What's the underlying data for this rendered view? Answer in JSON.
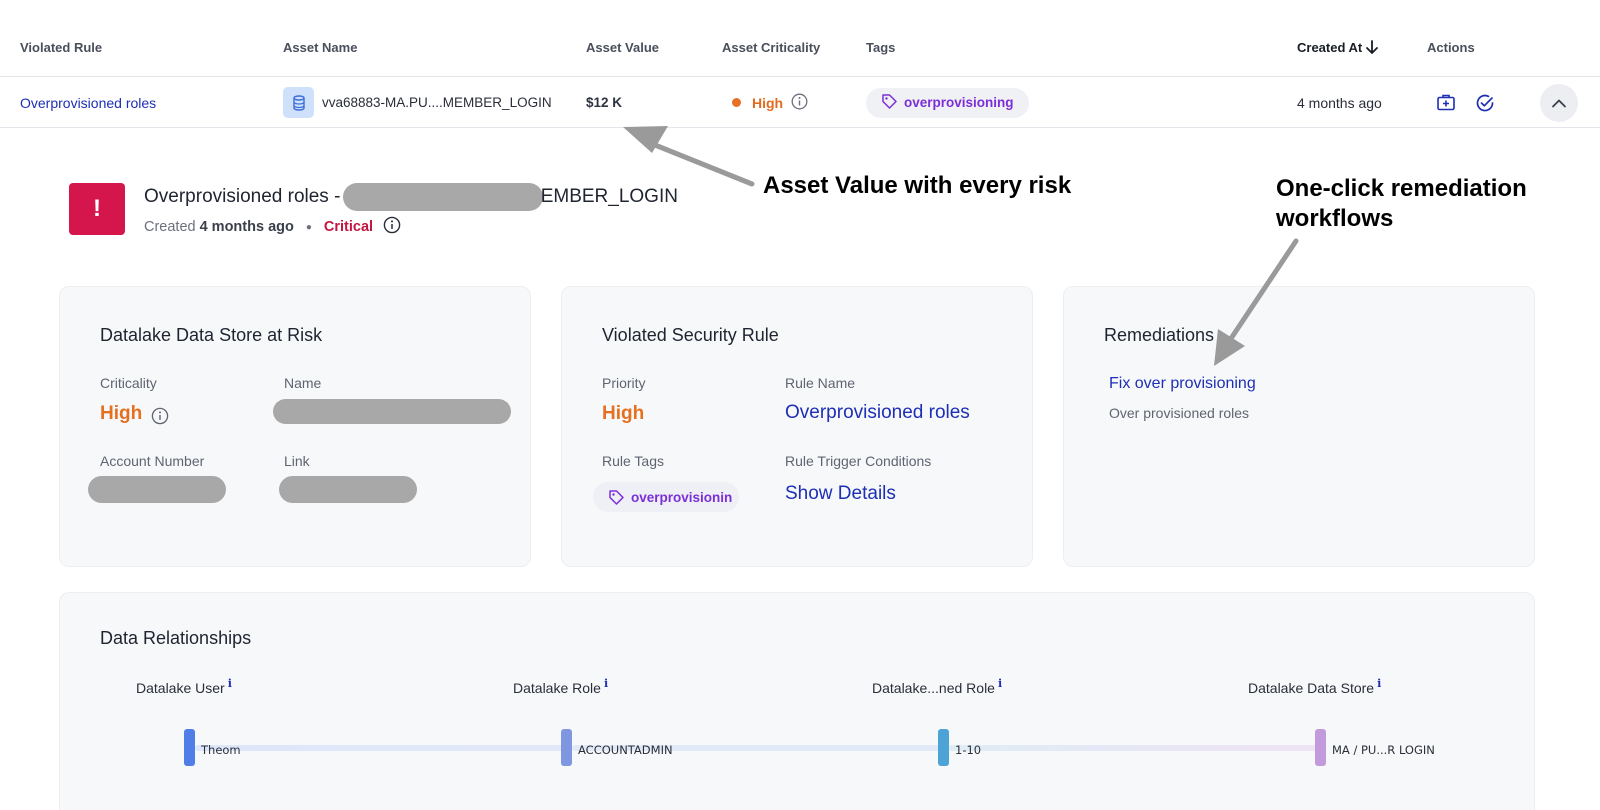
{
  "table": {
    "headers": {
      "violated_rule": "Violated Rule",
      "asset_name": "Asset Name",
      "asset_value": "Asset Value",
      "asset_criticality": "Asset Criticality",
      "tags": "Tags",
      "created_at": "Created At",
      "actions": "Actions"
    },
    "row": {
      "violated_rule": "Overprovisioned roles",
      "asset_name": "vva68883-MA.PU....MEMBER_LOGIN",
      "asset_value": "$12 K",
      "criticality": "High",
      "tag": "overprovisioning",
      "created_at": "4 months ago"
    }
  },
  "detail": {
    "title_prefix": "Overprovisioned roles - ",
    "title_suffix": "EMBER_LOGIN",
    "created_label": "Created",
    "created_value": "4 months ago",
    "severity": "Critical",
    "alert_glyph": "!"
  },
  "annotations": {
    "asset_value": "Asset Value with every risk",
    "remediation_line1": "One-click remediation",
    "remediation_line2": "workflows"
  },
  "card_datastore": {
    "title": "Datalake Data Store at Risk",
    "criticality_label": "Criticality",
    "criticality_value": "High",
    "name_label": "Name",
    "account_label": "Account Number",
    "link_label": "Link"
  },
  "card_rule": {
    "title": "Violated Security Rule",
    "priority_label": "Priority",
    "priority_value": "High",
    "rule_name_label": "Rule Name",
    "rule_name_value": "Overprovisioned roles",
    "rule_tags_label": "Rule Tags",
    "rule_tag_value": "overprovisionin",
    "trigger_label": "Rule Trigger Conditions",
    "trigger_value": "Show Details"
  },
  "card_remediations": {
    "title": "Remediations",
    "link": "Fix over provisioning",
    "desc": "Over provisioned roles"
  },
  "relationships": {
    "title": "Data Relationships",
    "info_glyph": "i",
    "columns": [
      {
        "header": "Datalake User",
        "node": "Theom",
        "color": "#4f7fe6"
      },
      {
        "header": "Datalake Role",
        "node": "ACCOUNTADMIN",
        "color": "#7e97e0"
      },
      {
        "header": "Datalake...ned Role",
        "node": "1-10",
        "color": "#4ea3d6"
      },
      {
        "header": "Datalake Data Store",
        "node": "MA / PU...R LOGIN",
        "color": "#c39adb"
      }
    ]
  },
  "colors": {
    "accent_blue": "#1d2fb5",
    "critical": "#c4143f",
    "high": "#e5701f",
    "tag_purple": "#7b2fd8"
  }
}
